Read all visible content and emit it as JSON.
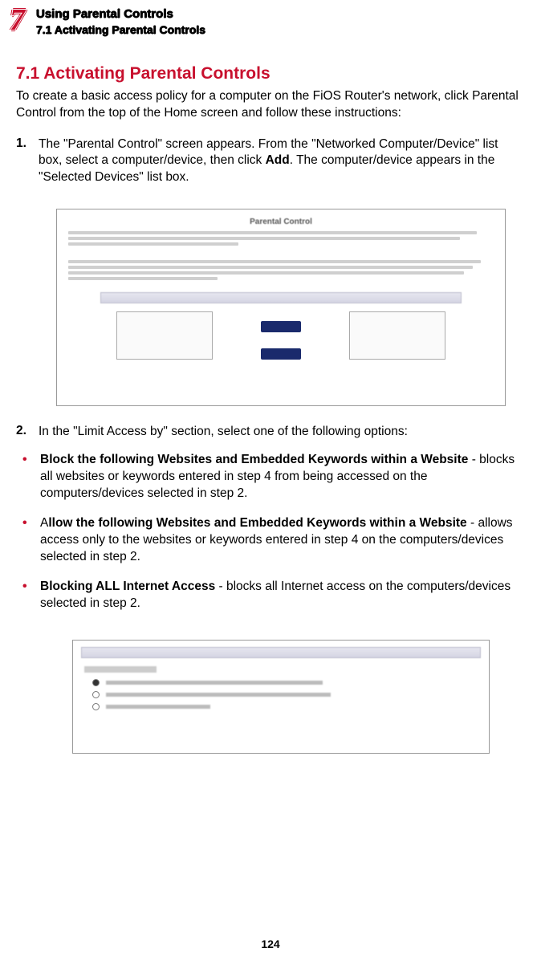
{
  "chapter": {
    "number": "7",
    "title_main": "Using Parental Controls",
    "title_sub": "7.1  Activating Parental Controls"
  },
  "section_heading": "7.1  Activating Parental Controls",
  "intro": "To create a basic access policy for a computer on the FiOS Router's network, click Parental Control from the top of the Home screen and follow these instructions:",
  "step1": {
    "num": "1.",
    "pre": "The \"Parental Control\" screen appears. From the \"Networked Computer/Device\" list box, select a computer/device, then click ",
    "bold": "Add",
    "post": ". The computer/device appears in the \"Selected Devices\" list box."
  },
  "ss1_title": "Parental Control",
  "step2": {
    "num": "2.",
    "text": "In the \"Limit Access by\" section, select one of the following options:"
  },
  "bullets": [
    {
      "bold": "Block the following Websites and Embedded Keywords within a Website",
      "rest": " - blocks all websites or keywords entered in step 4 from being accessed on the computers/devices selected in step 2."
    },
    {
      "pre": "A",
      "bold": "llow the following Websites and Embedded Keywords within a Website",
      "rest": " - allows access only to the websites or keywords entered in step 4 on the computers/devices selected in step 2."
    },
    {
      "bold": "Blocking ALL Internet Access",
      "rest": " - blocks all Internet access on the computers/devices selected in step 2."
    }
  ],
  "page_number": "124"
}
